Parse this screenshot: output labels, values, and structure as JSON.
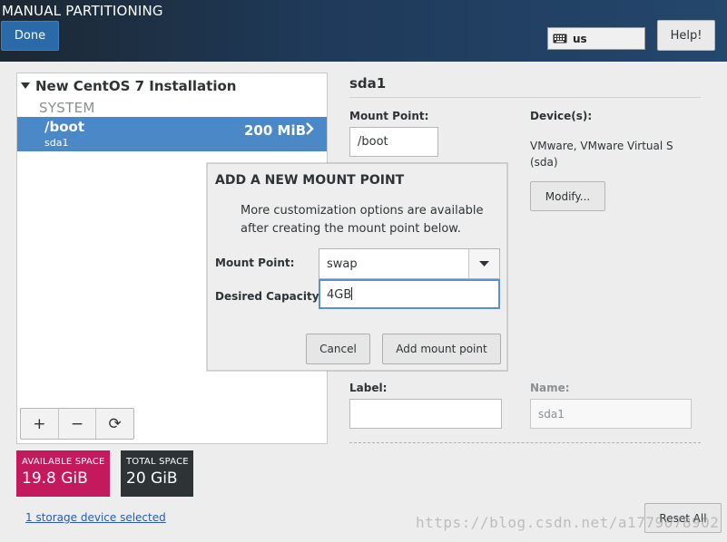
{
  "header": {
    "title": "MANUAL PARTITIONING",
    "done_label": "Done",
    "keyboard_layout": "us",
    "help_label": "Help!"
  },
  "left_panel": {
    "installation_title": "New CentOS 7 Installation",
    "section_label": "SYSTEM",
    "partitions": [
      {
        "mount": "/boot",
        "device": "sda1",
        "size": "200 MiB"
      }
    ],
    "toolbar": {
      "add": "+",
      "remove": "−",
      "refresh": "⟳"
    }
  },
  "space": {
    "available_label": "AVAILABLE SPACE",
    "available_value": "19.8 GiB",
    "total_label": "TOTAL SPACE",
    "total_value": "20 GiB",
    "storage_link": "1 storage device selected"
  },
  "details": {
    "title": "sda1",
    "mount_point_label": "Mount Point:",
    "mount_point_value": "/boot",
    "devices_label": "Device(s):",
    "devices_text": "VMware, VMware Virtual S (sda)",
    "modify_label": "Modify...",
    "label_label": "Label:",
    "name_label": "Name:",
    "name_value": "sda1",
    "reset_label": "Reset All"
  },
  "dialog": {
    "title": "ADD A NEW MOUNT POINT",
    "description": "More customization options are available after creating the mount point below.",
    "mount_point_label": "Mount Point:",
    "mount_point_value": "swap",
    "capacity_label": "Desired Capacity:",
    "capacity_value": "4GB",
    "cancel_label": "Cancel",
    "add_label": "Add mount point"
  },
  "watermark": "https://blog.csdn.net/a1779078902",
  "colors": {
    "selected_row": "#4a88c7",
    "available_space": "#c5195e",
    "total_space": "#2e3436",
    "done_button": "#2b6aa8"
  }
}
